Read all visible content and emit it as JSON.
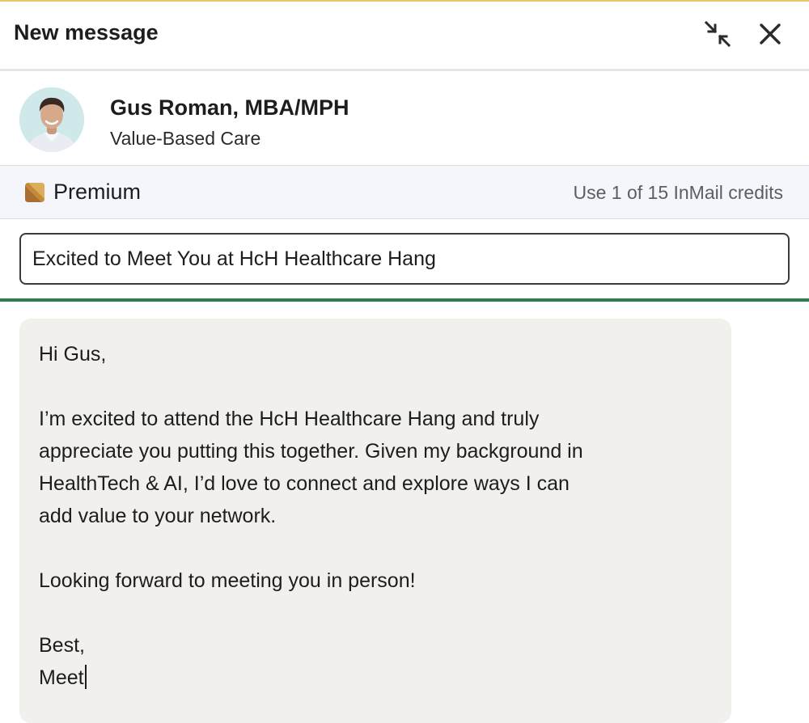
{
  "dialog": {
    "title": "New message",
    "minimize_icon": "minimize-arrows-icon",
    "close_icon": "close-icon"
  },
  "recipient": {
    "name": "Gus Roman, MBA/MPH",
    "headline": "Value-Based Care"
  },
  "premium": {
    "label": "Premium",
    "credits_text": "Use 1 of 15 InMail credits",
    "icon_color": "#c48a3a"
  },
  "subject": {
    "value": "Excited to Meet You at HcH Healthcare Hang"
  },
  "message": {
    "greeting": "Hi Gus,",
    "paragraph_1": "I’m excited to attend the HcH Healthcare Hang and truly\nappreciate you putting this together. Given my background in\nHealthTech & AI, I’d love to connect and explore ways I can\nadd value to your network.",
    "paragraph_2": "Looking forward to meeting you in person!",
    "signoff": "Best,",
    "signature": "Meet"
  },
  "colors": {
    "accent_green": "#2e7d4f",
    "premium_bg": "#f4f6fb",
    "message_bg": "#f1f0ec"
  }
}
